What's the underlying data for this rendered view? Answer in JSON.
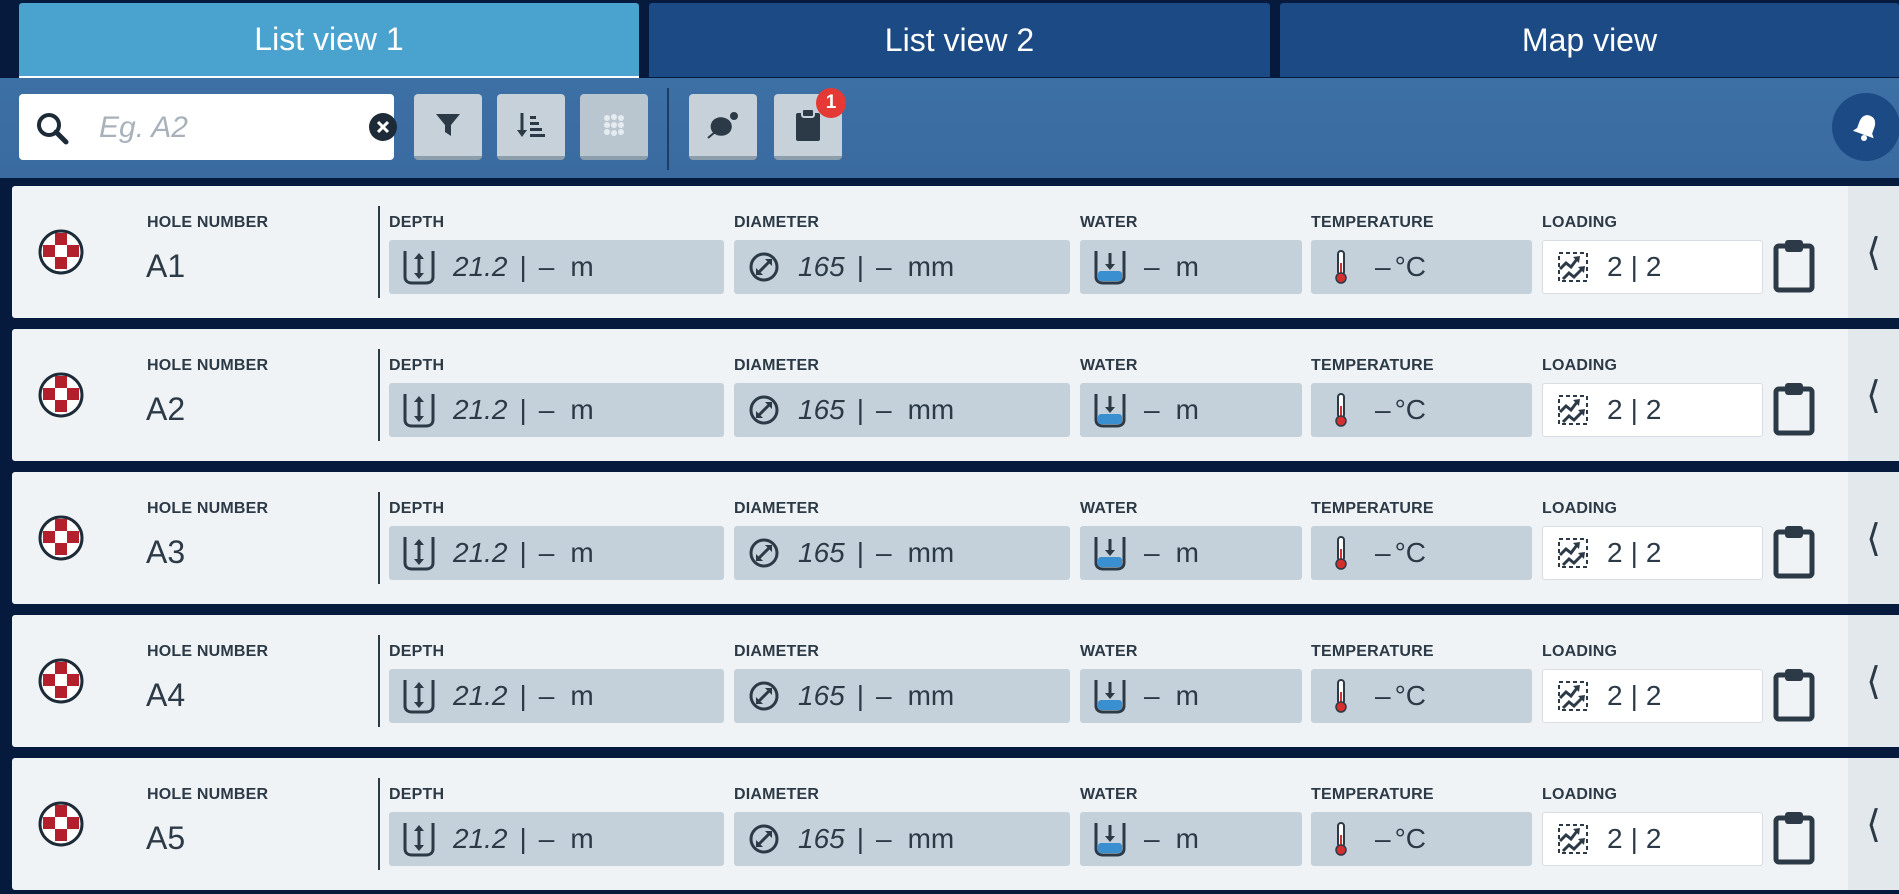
{
  "tabs": [
    {
      "label": "List view 1",
      "active": true
    },
    {
      "label": "List view 2",
      "active": false
    },
    {
      "label": "Map view",
      "active": false
    }
  ],
  "toolbar": {
    "search_placeholder": "Eg. A2",
    "search_value": "",
    "buttons": [
      "filter-icon",
      "sort-icon",
      "pattern-icon",
      "rocks-icon",
      "clipboard-icon",
      "bell-icon"
    ],
    "clipboard_badge": "1"
  },
  "labels": {
    "hole_number": "HOLE NUMBER",
    "depth": "DEPTH",
    "diameter": "DIAMETER",
    "water": "WATER",
    "temperature": "TEMPERATURE",
    "loading": "LOADING"
  },
  "rows": [
    {
      "hole": "A1",
      "depth": "21.2",
      "depth_actual": "–",
      "depth_unit": "m",
      "diameter": "165",
      "diameter_actual": "–",
      "diameter_unit": "mm",
      "water": "–",
      "water_unit": "m",
      "temperature": "–",
      "temperature_unit": "°C",
      "loading_a": "2",
      "loading_b": "2"
    },
    {
      "hole": "A2",
      "depth": "21.2",
      "depth_actual": "–",
      "depth_unit": "m",
      "diameter": "165",
      "diameter_actual": "–",
      "diameter_unit": "mm",
      "water": "–",
      "water_unit": "m",
      "temperature": "–",
      "temperature_unit": "°C",
      "loading_a": "2",
      "loading_b": "2"
    },
    {
      "hole": "A3",
      "depth": "21.2",
      "depth_actual": "–",
      "depth_unit": "m",
      "diameter": "165",
      "diameter_actual": "–",
      "diameter_unit": "mm",
      "water": "–",
      "water_unit": "m",
      "temperature": "–",
      "temperature_unit": "°C",
      "loading_a": "2",
      "loading_b": "2"
    },
    {
      "hole": "A4",
      "depth": "21.2",
      "depth_actual": "–",
      "depth_unit": "m",
      "diameter": "165",
      "diameter_actual": "–",
      "diameter_unit": "mm",
      "water": "–",
      "water_unit": "m",
      "temperature": "–",
      "temperature_unit": "°C",
      "loading_a": "2",
      "loading_b": "2"
    },
    {
      "hole": "A5",
      "depth": "21.2",
      "depth_actual": "–",
      "depth_unit": "m",
      "diameter": "165",
      "diameter_actual": "–",
      "diameter_unit": "mm",
      "water": "–",
      "water_unit": "m",
      "temperature": "–",
      "temperature_unit": "°C",
      "loading_a": "2",
      "loading_b": "2"
    }
  ],
  "colors": {
    "status_icon": "#b3202c",
    "water_fill": "#3a8fd0",
    "thermo": "#d32f2f",
    "badge": "#e53935"
  }
}
